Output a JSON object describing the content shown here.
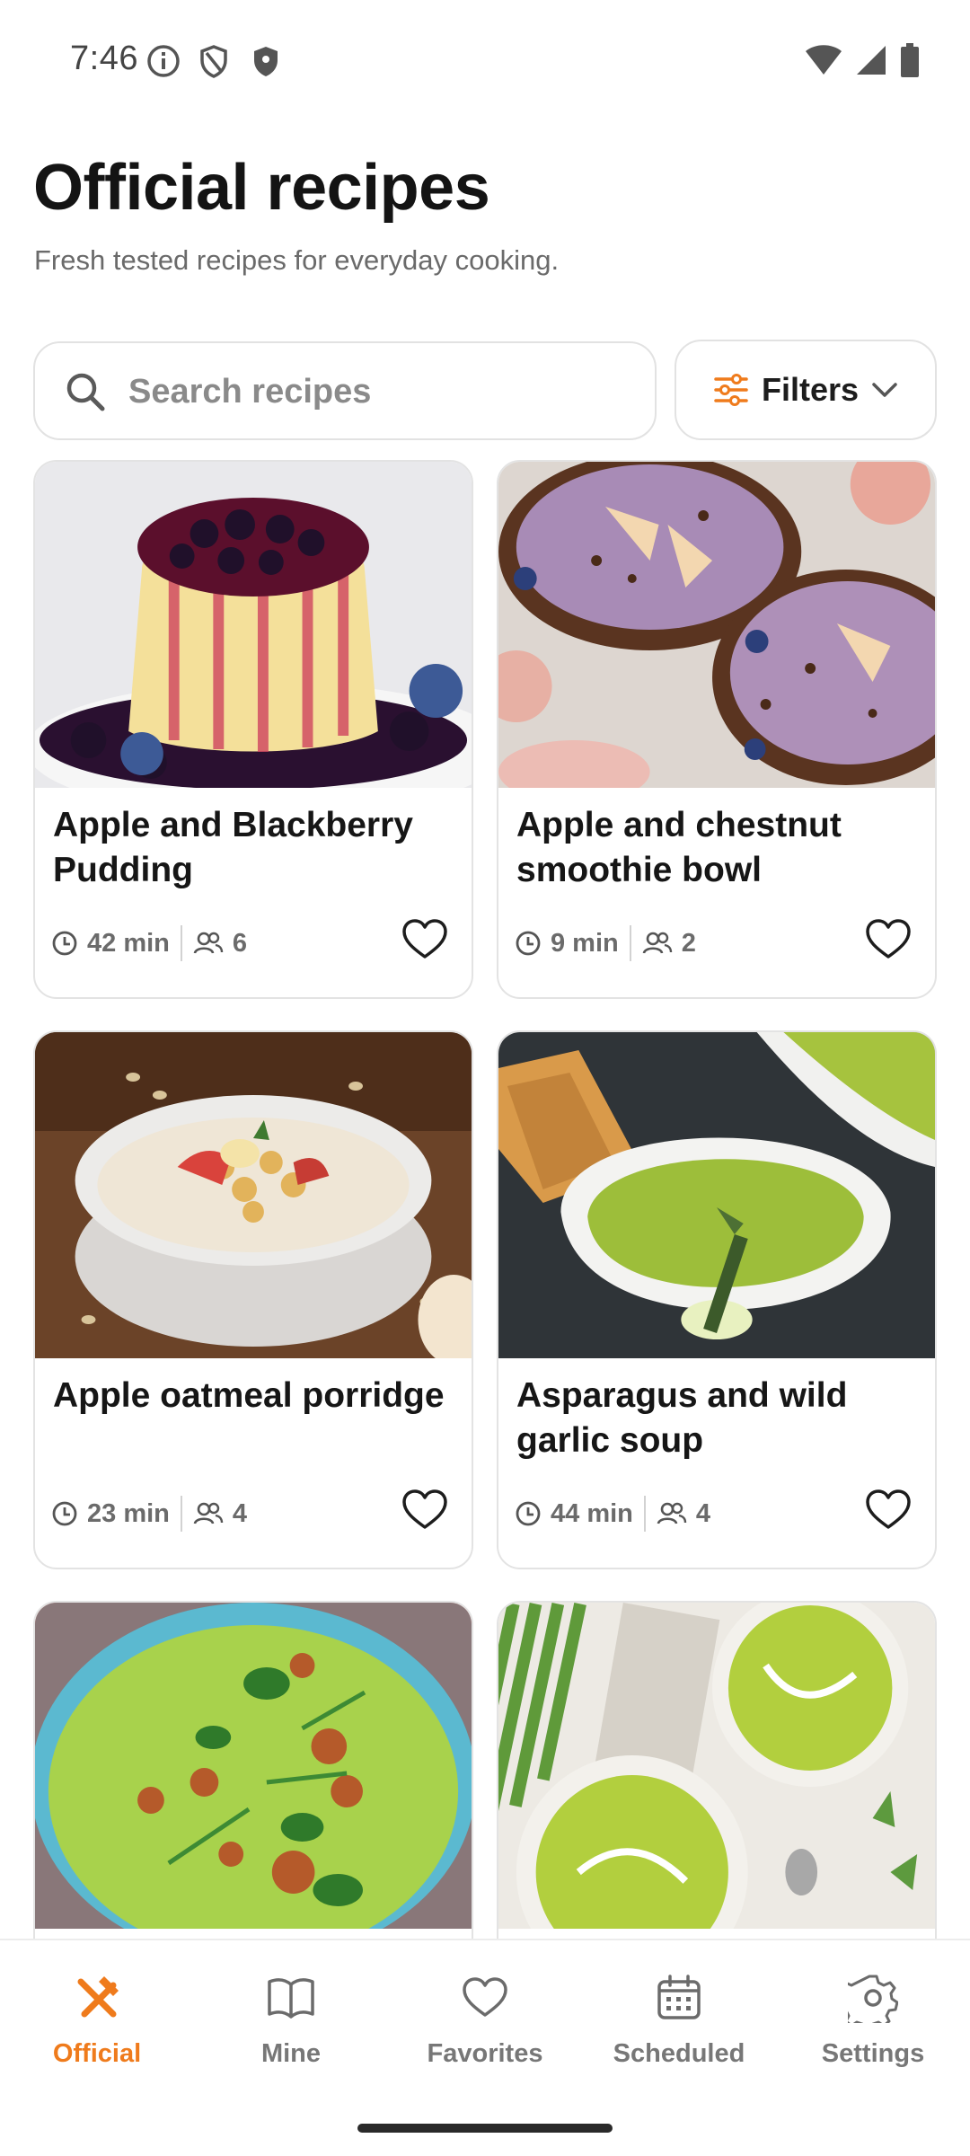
{
  "status_bar": {
    "time": "7:46",
    "icons_left": [
      "info-icon",
      "shield-outline-icon",
      "shield-filled-icon"
    ],
    "icons_right": [
      "wifi-icon",
      "cellular-signal-icon",
      "battery-icon"
    ]
  },
  "header": {
    "title": "Official recipes",
    "subtitle": "Fresh tested recipes for everyday cooking."
  },
  "search": {
    "placeholder": "Search recipes",
    "value": ""
  },
  "filters": {
    "label": "Filters",
    "icon": "sliders-icon",
    "chevron": "chevron-down-icon"
  },
  "colors": {
    "accent": "#ef7b1c",
    "text_primary": "#161616",
    "text_muted": "#6b6b6b",
    "border": "#e3e3e3"
  },
  "recipes": [
    {
      "title": "Apple and Blackberry Pudding",
      "time": "42 min",
      "servings": "6",
      "favorite": false,
      "image": "pudding-with-berry-sauce"
    },
    {
      "title": "Apple and chestnut smoothie bowl",
      "time": "9 min",
      "servings": "2",
      "favorite": false,
      "image": "smoothie-bowls-in-coconut-shells"
    },
    {
      "title": "Apple oatmeal porridge",
      "time": "23 min",
      "servings": "4",
      "favorite": false,
      "image": "oatmeal-bowl-with-apple"
    },
    {
      "title": "Asparagus and wild garlic soup",
      "time": "44 min",
      "servings": "4",
      "favorite": false,
      "image": "green-soup-bowl"
    },
    {
      "title": "",
      "time": "",
      "servings": "",
      "favorite": false,
      "image": "green-soup-with-croutons"
    },
    {
      "title": "",
      "time": "",
      "servings": "",
      "favorite": false,
      "image": "asparagus-soup-bowls"
    }
  ],
  "bottom_nav": {
    "items": [
      {
        "label": "Official",
        "icon": "fork-knife-icon",
        "active": true
      },
      {
        "label": "Mine",
        "icon": "book-icon",
        "active": false
      },
      {
        "label": "Favorites",
        "icon": "heart-icon",
        "active": false
      },
      {
        "label": "Scheduled",
        "icon": "calendar-icon",
        "active": false
      },
      {
        "label": "Settings",
        "icon": "gear-icon",
        "active": false
      }
    ]
  }
}
